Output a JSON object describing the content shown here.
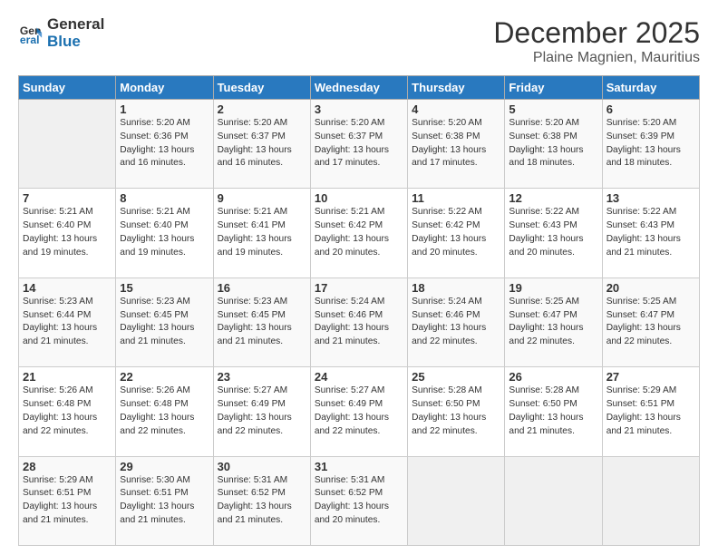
{
  "header": {
    "logo_line1": "General",
    "logo_line2": "Blue",
    "month": "December 2025",
    "location": "Plaine Magnien, Mauritius"
  },
  "weekdays": [
    "Sunday",
    "Monday",
    "Tuesday",
    "Wednesday",
    "Thursday",
    "Friday",
    "Saturday"
  ],
  "weeks": [
    [
      {
        "num": "",
        "info": ""
      },
      {
        "num": "1",
        "info": "Sunrise: 5:20 AM\nSunset: 6:36 PM\nDaylight: 13 hours\nand 16 minutes."
      },
      {
        "num": "2",
        "info": "Sunrise: 5:20 AM\nSunset: 6:37 PM\nDaylight: 13 hours\nand 16 minutes."
      },
      {
        "num": "3",
        "info": "Sunrise: 5:20 AM\nSunset: 6:37 PM\nDaylight: 13 hours\nand 17 minutes."
      },
      {
        "num": "4",
        "info": "Sunrise: 5:20 AM\nSunset: 6:38 PM\nDaylight: 13 hours\nand 17 minutes."
      },
      {
        "num": "5",
        "info": "Sunrise: 5:20 AM\nSunset: 6:38 PM\nDaylight: 13 hours\nand 18 minutes."
      },
      {
        "num": "6",
        "info": "Sunrise: 5:20 AM\nSunset: 6:39 PM\nDaylight: 13 hours\nand 18 minutes."
      }
    ],
    [
      {
        "num": "7",
        "info": "Sunrise: 5:21 AM\nSunset: 6:40 PM\nDaylight: 13 hours\nand 19 minutes."
      },
      {
        "num": "8",
        "info": "Sunrise: 5:21 AM\nSunset: 6:40 PM\nDaylight: 13 hours\nand 19 minutes."
      },
      {
        "num": "9",
        "info": "Sunrise: 5:21 AM\nSunset: 6:41 PM\nDaylight: 13 hours\nand 19 minutes."
      },
      {
        "num": "10",
        "info": "Sunrise: 5:21 AM\nSunset: 6:42 PM\nDaylight: 13 hours\nand 20 minutes."
      },
      {
        "num": "11",
        "info": "Sunrise: 5:22 AM\nSunset: 6:42 PM\nDaylight: 13 hours\nand 20 minutes."
      },
      {
        "num": "12",
        "info": "Sunrise: 5:22 AM\nSunset: 6:43 PM\nDaylight: 13 hours\nand 20 minutes."
      },
      {
        "num": "13",
        "info": "Sunrise: 5:22 AM\nSunset: 6:43 PM\nDaylight: 13 hours\nand 21 minutes."
      }
    ],
    [
      {
        "num": "14",
        "info": "Sunrise: 5:23 AM\nSunset: 6:44 PM\nDaylight: 13 hours\nand 21 minutes."
      },
      {
        "num": "15",
        "info": "Sunrise: 5:23 AM\nSunset: 6:45 PM\nDaylight: 13 hours\nand 21 minutes."
      },
      {
        "num": "16",
        "info": "Sunrise: 5:23 AM\nSunset: 6:45 PM\nDaylight: 13 hours\nand 21 minutes."
      },
      {
        "num": "17",
        "info": "Sunrise: 5:24 AM\nSunset: 6:46 PM\nDaylight: 13 hours\nand 21 minutes."
      },
      {
        "num": "18",
        "info": "Sunrise: 5:24 AM\nSunset: 6:46 PM\nDaylight: 13 hours\nand 22 minutes."
      },
      {
        "num": "19",
        "info": "Sunrise: 5:25 AM\nSunset: 6:47 PM\nDaylight: 13 hours\nand 22 minutes."
      },
      {
        "num": "20",
        "info": "Sunrise: 5:25 AM\nSunset: 6:47 PM\nDaylight: 13 hours\nand 22 minutes."
      }
    ],
    [
      {
        "num": "21",
        "info": "Sunrise: 5:26 AM\nSunset: 6:48 PM\nDaylight: 13 hours\nand 22 minutes."
      },
      {
        "num": "22",
        "info": "Sunrise: 5:26 AM\nSunset: 6:48 PM\nDaylight: 13 hours\nand 22 minutes."
      },
      {
        "num": "23",
        "info": "Sunrise: 5:27 AM\nSunset: 6:49 PM\nDaylight: 13 hours\nand 22 minutes."
      },
      {
        "num": "24",
        "info": "Sunrise: 5:27 AM\nSunset: 6:49 PM\nDaylight: 13 hours\nand 22 minutes."
      },
      {
        "num": "25",
        "info": "Sunrise: 5:28 AM\nSunset: 6:50 PM\nDaylight: 13 hours\nand 22 minutes."
      },
      {
        "num": "26",
        "info": "Sunrise: 5:28 AM\nSunset: 6:50 PM\nDaylight: 13 hours\nand 21 minutes."
      },
      {
        "num": "27",
        "info": "Sunrise: 5:29 AM\nSunset: 6:51 PM\nDaylight: 13 hours\nand 21 minutes."
      }
    ],
    [
      {
        "num": "28",
        "info": "Sunrise: 5:29 AM\nSunset: 6:51 PM\nDaylight: 13 hours\nand 21 minutes."
      },
      {
        "num": "29",
        "info": "Sunrise: 5:30 AM\nSunset: 6:51 PM\nDaylight: 13 hours\nand 21 minutes."
      },
      {
        "num": "30",
        "info": "Sunrise: 5:31 AM\nSunset: 6:52 PM\nDaylight: 13 hours\nand 21 minutes."
      },
      {
        "num": "31",
        "info": "Sunrise: 5:31 AM\nSunset: 6:52 PM\nDaylight: 13 hours\nand 20 minutes."
      },
      {
        "num": "",
        "info": ""
      },
      {
        "num": "",
        "info": ""
      },
      {
        "num": "",
        "info": ""
      }
    ]
  ]
}
